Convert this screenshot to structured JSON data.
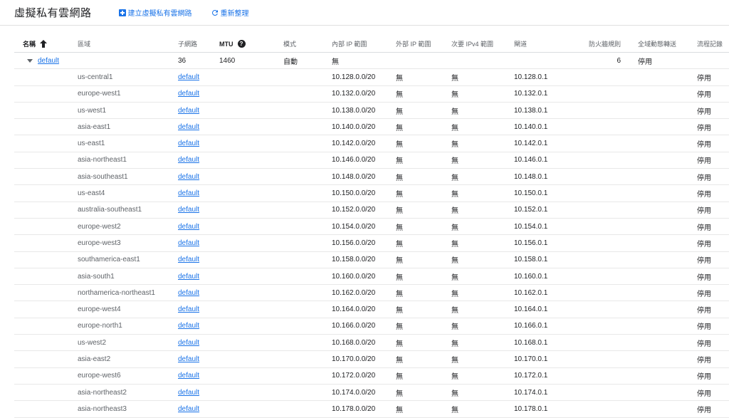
{
  "header": {
    "title": "虛擬私有雲網路",
    "create_label": "建立虛擬私有雲網路",
    "refresh_label": "重新整理"
  },
  "columns": {
    "name": "名稱",
    "region": "區域",
    "subnets": "子網路",
    "mtu": "MTU",
    "mode": "模式",
    "internal_ip": "內部 IP 範圍",
    "external_ip": "外部 IP 範圍",
    "secondary": "次要 IPv4 範圍",
    "gateway": "閘道",
    "firewall": "防火牆規則",
    "routing": "全域動態轉送",
    "flow_logs": "流程記錄"
  },
  "network": {
    "name": "default",
    "subnets": "36",
    "mtu": "1460",
    "mode": "自動",
    "internal_ip": "無",
    "firewall": "6",
    "routing": "停用"
  },
  "subnets": [
    {
      "region": "us-central1",
      "name": "default",
      "internal": "10.128.0.0/20",
      "external": "無",
      "secondary": "無",
      "gateway": "10.128.0.1",
      "flow": "停用"
    },
    {
      "region": "europe-west1",
      "name": "default",
      "internal": "10.132.0.0/20",
      "external": "無",
      "secondary": "無",
      "gateway": "10.132.0.1",
      "flow": "停用"
    },
    {
      "region": "us-west1",
      "name": "default",
      "internal": "10.138.0.0/20",
      "external": "無",
      "secondary": "無",
      "gateway": "10.138.0.1",
      "flow": "停用"
    },
    {
      "region": "asia-east1",
      "name": "default",
      "internal": "10.140.0.0/20",
      "external": "無",
      "secondary": "無",
      "gateway": "10.140.0.1",
      "flow": "停用"
    },
    {
      "region": "us-east1",
      "name": "default",
      "internal": "10.142.0.0/20",
      "external": "無",
      "secondary": "無",
      "gateway": "10.142.0.1",
      "flow": "停用"
    },
    {
      "region": "asia-northeast1",
      "name": "default",
      "internal": "10.146.0.0/20",
      "external": "無",
      "secondary": "無",
      "gateway": "10.146.0.1",
      "flow": "停用"
    },
    {
      "region": "asia-southeast1",
      "name": "default",
      "internal": "10.148.0.0/20",
      "external": "無",
      "secondary": "無",
      "gateway": "10.148.0.1",
      "flow": "停用"
    },
    {
      "region": "us-east4",
      "name": "default",
      "internal": "10.150.0.0/20",
      "external": "無",
      "secondary": "無",
      "gateway": "10.150.0.1",
      "flow": "停用"
    },
    {
      "region": "australia-southeast1",
      "name": "default",
      "internal": "10.152.0.0/20",
      "external": "無",
      "secondary": "無",
      "gateway": "10.152.0.1",
      "flow": "停用"
    },
    {
      "region": "europe-west2",
      "name": "default",
      "internal": "10.154.0.0/20",
      "external": "無",
      "secondary": "無",
      "gateway": "10.154.0.1",
      "flow": "停用"
    },
    {
      "region": "europe-west3",
      "name": "default",
      "internal": "10.156.0.0/20",
      "external": "無",
      "secondary": "無",
      "gateway": "10.156.0.1",
      "flow": "停用"
    },
    {
      "region": "southamerica-east1",
      "name": "default",
      "internal": "10.158.0.0/20",
      "external": "無",
      "secondary": "無",
      "gateway": "10.158.0.1",
      "flow": "停用"
    },
    {
      "region": "asia-south1",
      "name": "default",
      "internal": "10.160.0.0/20",
      "external": "無",
      "secondary": "無",
      "gateway": "10.160.0.1",
      "flow": "停用"
    },
    {
      "region": "northamerica-northeast1",
      "name": "default",
      "internal": "10.162.0.0/20",
      "external": "無",
      "secondary": "無",
      "gateway": "10.162.0.1",
      "flow": "停用"
    },
    {
      "region": "europe-west4",
      "name": "default",
      "internal": "10.164.0.0/20",
      "external": "無",
      "secondary": "無",
      "gateway": "10.164.0.1",
      "flow": "停用"
    },
    {
      "region": "europe-north1",
      "name": "default",
      "internal": "10.166.0.0/20",
      "external": "無",
      "secondary": "無",
      "gateway": "10.166.0.1",
      "flow": "停用"
    },
    {
      "region": "us-west2",
      "name": "default",
      "internal": "10.168.0.0/20",
      "external": "無",
      "secondary": "無",
      "gateway": "10.168.0.1",
      "flow": "停用"
    },
    {
      "region": "asia-east2",
      "name": "default",
      "internal": "10.170.0.0/20",
      "external": "無",
      "secondary": "無",
      "gateway": "10.170.0.1",
      "flow": "停用"
    },
    {
      "region": "europe-west6",
      "name": "default",
      "internal": "10.172.0.0/20",
      "external": "無",
      "secondary": "無",
      "gateway": "10.172.0.1",
      "flow": "停用"
    },
    {
      "region": "asia-northeast2",
      "name": "default",
      "internal": "10.174.0.0/20",
      "external": "無",
      "secondary": "無",
      "gateway": "10.174.0.1",
      "flow": "停用"
    },
    {
      "region": "asia-northeast3",
      "name": "default",
      "internal": "10.178.0.0/20",
      "external": "無",
      "secondary": "無",
      "gateway": "10.178.0.1",
      "flow": "停用"
    }
  ]
}
